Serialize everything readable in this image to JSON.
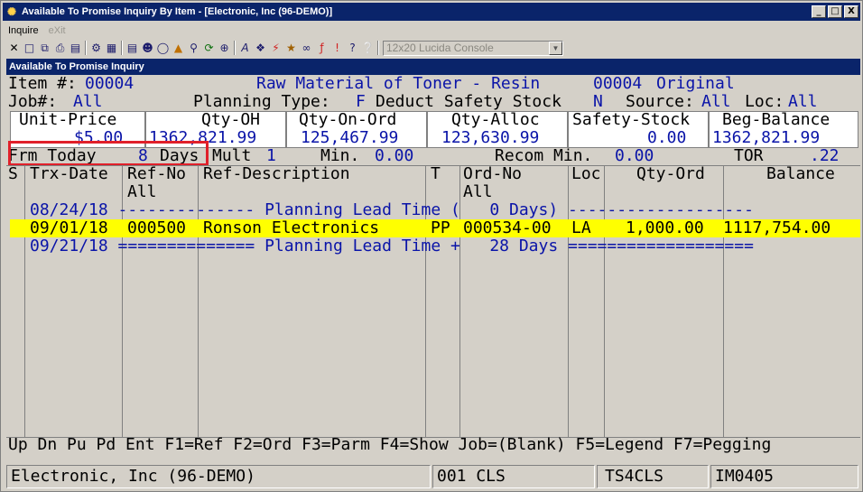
{
  "window": {
    "title": "Available To Promise Inquiry By Item - [Electronic, Inc (96-DEMO)]",
    "min": "_",
    "max": "□",
    "close": "X"
  },
  "menu": {
    "inquire": "Inquire",
    "exit": "eXit"
  },
  "toolbar": {
    "font_value": "12x20 Lucida Console"
  },
  "panel": {
    "title": "Available To Promise Inquiry"
  },
  "item": {
    "label": "Item #:",
    "number": "00004",
    "desc": "Raw Material of Toner - Resin",
    "id2": "00004",
    "status": "Original"
  },
  "params": {
    "job_label": "Job#:",
    "job": "All",
    "plan_label": "Planning Type:",
    "plan": "F",
    "dss_label": "Deduct Safety Stock",
    "dss": "N",
    "source_label": "Source:",
    "source": "All",
    "loc_label": "Loc:",
    "loc": "All"
  },
  "summary": {
    "headers": [
      "Unit-Price",
      "Qty-OH",
      "Qty-On-Ord",
      "Qty-Alloc",
      "Safety-Stock",
      "Beg-Balance"
    ],
    "values": [
      "$5.00",
      "1362,821.99",
      "125,467.99",
      "123,630.99",
      "0.00",
      "1362,821.99"
    ]
  },
  "options": {
    "frm_label": "Frm Today",
    "frm_value": "8",
    "frm_unit": "Days",
    "mult_label": "Mult",
    "mult_value": "1",
    "min_label": "Min.",
    "min_value": "0.00",
    "recom_label": "Recom Min.",
    "recom_value": "0.00",
    "tor_label": "TOR",
    "tor_value": ".22"
  },
  "columns": {
    "s": "S",
    "trx_date": "Trx-Date",
    "ref_no": "Ref-No",
    "ref_no_filter": "All",
    "ref_desc": "Ref-Description",
    "t": "T",
    "ord_no": "Ord-No",
    "ord_no_filter": "All",
    "loc": "Loc",
    "qty_ord": "Qty-Ord",
    "balance": "Balance"
  },
  "rows": [
    {
      "line": "08/24/18 -------------- Planning Lead Time (   0 Days) -------------------"
    },
    {
      "date": "09/01/18",
      "ref_no": "000500",
      "ref_desc": "Ronson Electronics",
      "t": "PP",
      "ord_no": "000534-00",
      "loc": "LA",
      "qty_ord": "1,000.00",
      "balance": "1117,754.00"
    },
    {
      "line": "09/21/18 ============== Planning Lead Time +   28 Days ==================="
    }
  ],
  "fkeys": "Up Dn Pu Pd Ent F1=Ref F2=Ord F3=Parm F4=Show Job=(Blank) F5=Legend F7=Pegging",
  "status": {
    "company": "Electronic, Inc (96-DEMO)",
    "code": "001 CLS",
    "server": "TS4CLS",
    "program": "IM0405"
  },
  "colors": {
    "title_bar": "#0a246a",
    "value_text": "#0a14a8",
    "highlight_row": "#ffff00",
    "annotation_box": "#e0202a"
  }
}
